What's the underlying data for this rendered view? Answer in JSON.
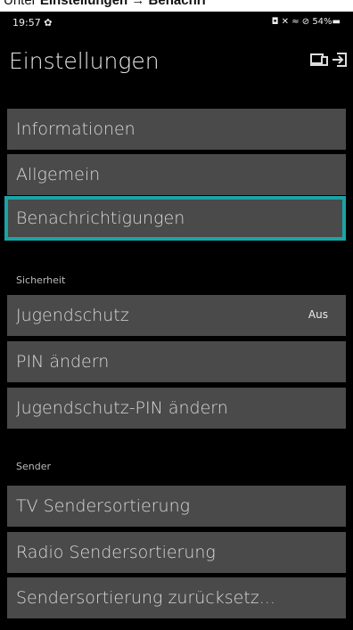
{
  "caption": {
    "prefix": "Unter ",
    "bold1": "Einstellungen",
    "arrow": " → ",
    "bold2": "Benachri"
  },
  "status": {
    "time": "19:57",
    "icons_left": "✿",
    "icons_right": "◘ ✕ ≈ ⊘ 54%▬"
  },
  "header": {
    "title": "Einstellungen"
  },
  "menu": {
    "informationen": "Informationen",
    "allgemein": "Allgemein",
    "benachrichtigungen": "Benachrichtigungen"
  },
  "sicherheit": {
    "label": "Sicherheit",
    "jugendschutz": "Jugendschutz",
    "jugendschutz_value": "Aus",
    "pin": "PIN ändern",
    "jugendschutz_pin": "Jugendschutz-PIN ändern"
  },
  "sender": {
    "label": "Sender",
    "tv": "TV Sendersortierung",
    "radio": "Radio Sendersortierung",
    "reset": "Sendersortierung zurücksetz..."
  },
  "icons": {
    "cast": "cast-icon",
    "logout": "logout-icon"
  },
  "colors": {
    "row_bg": "#4a4a4a",
    "highlight": "#1aa4a6"
  }
}
